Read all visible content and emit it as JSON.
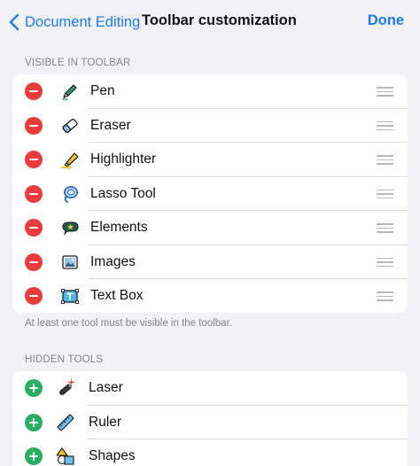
{
  "nav": {
    "back_label": "Document Editing",
    "title": "Toolbar customization",
    "done_label": "Done"
  },
  "visible_section": {
    "header": "VISIBLE IN TOOLBAR",
    "footnote": "At least one tool must be visible in the toolbar.",
    "items": [
      {
        "label": "Pen",
        "icon": "pen-icon"
      },
      {
        "label": "Eraser",
        "icon": "eraser-icon"
      },
      {
        "label": "Highlighter",
        "icon": "highlighter-icon"
      },
      {
        "label": "Lasso Tool",
        "icon": "lasso-icon"
      },
      {
        "label": "Elements",
        "icon": "elements-icon"
      },
      {
        "label": "Images",
        "icon": "images-icon"
      },
      {
        "label": "Text Box",
        "icon": "text-box-icon"
      }
    ]
  },
  "hidden_section": {
    "header": "HIDDEN TOOLS",
    "items": [
      {
        "label": "Laser",
        "icon": "laser-icon"
      },
      {
        "label": "Ruler",
        "icon": "ruler-icon"
      },
      {
        "label": "Shapes",
        "icon": "shapes-icon"
      }
    ]
  },
  "colors": {
    "accent": "#1a7cf3",
    "remove": "#eb3b3b",
    "add": "#2aae63",
    "background": "#f2f1f6"
  }
}
